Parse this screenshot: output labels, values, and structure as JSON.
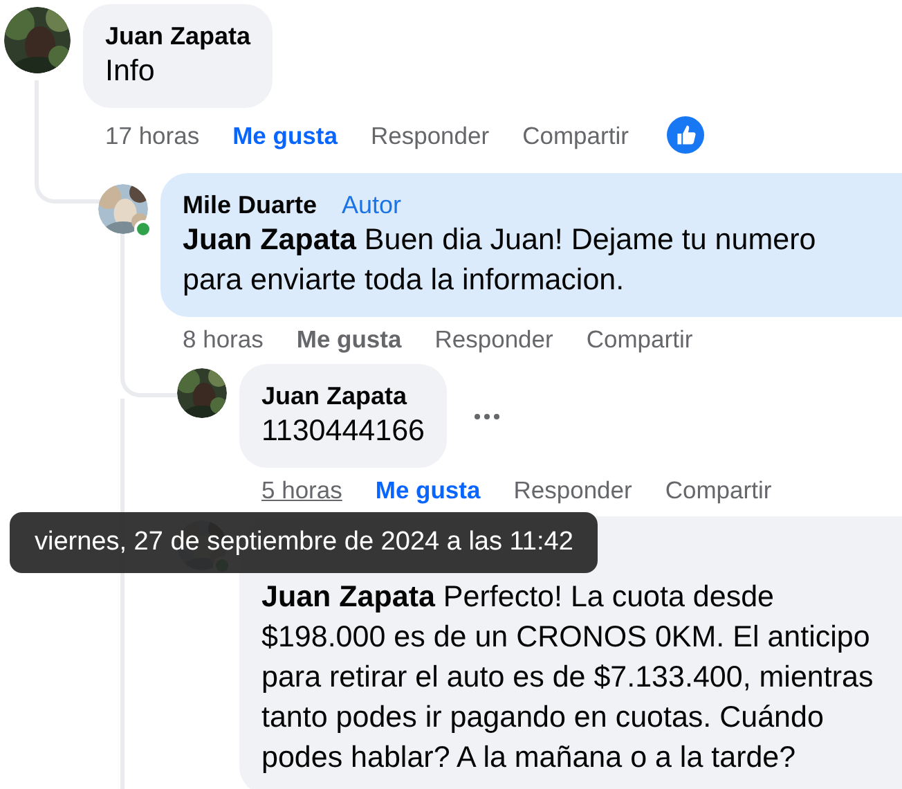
{
  "comments": [
    {
      "author": "Juan Zapata",
      "online": false,
      "highlighted": false,
      "text": "Info",
      "time": "17 horas",
      "time_hovered": false,
      "like": {
        "label": "Me gusta",
        "selected": true
      },
      "reply": "Responder",
      "share": "Compartir",
      "reacted": true,
      "children": [
        {
          "author": "Mile Duarte",
          "badge": "Autor",
          "online": true,
          "highlighted": true,
          "text": "**Juan Zapata** Buen dia Juan! Dejame tu numero para enviarte toda la informacion.",
          "time": "8 horas",
          "time_hovered": false,
          "like": {
            "label": "Me gusta",
            "selected": false
          },
          "reply": "Responder",
          "share": "Compartir",
          "children": [
            {
              "author": "Juan Zapata",
              "online": false,
              "highlighted": false,
              "text": "1130444166",
              "more_menu": true,
              "time": "5 horas",
              "time_hovered": true,
              "like": {
                "label": "Me gusta",
                "selected": true
              },
              "reply": "Responder",
              "share": "Compartir"
            },
            {
              "online": true,
              "highlighted": false,
              "text": "**Juan Zapata** Perfecto! La cuota desde $198.000 es de un CRONOS 0KM. El anticipo para retirar el auto es de $7.133.400, mientras tanto podes ir pagando en cuotas. Cuándo podes hablar? A la mañana o a la tarde?"
            }
          ]
        }
      ]
    }
  ],
  "tooltip": {
    "text": "viernes, 27 de septiembre de 2024 a las 11:42"
  }
}
